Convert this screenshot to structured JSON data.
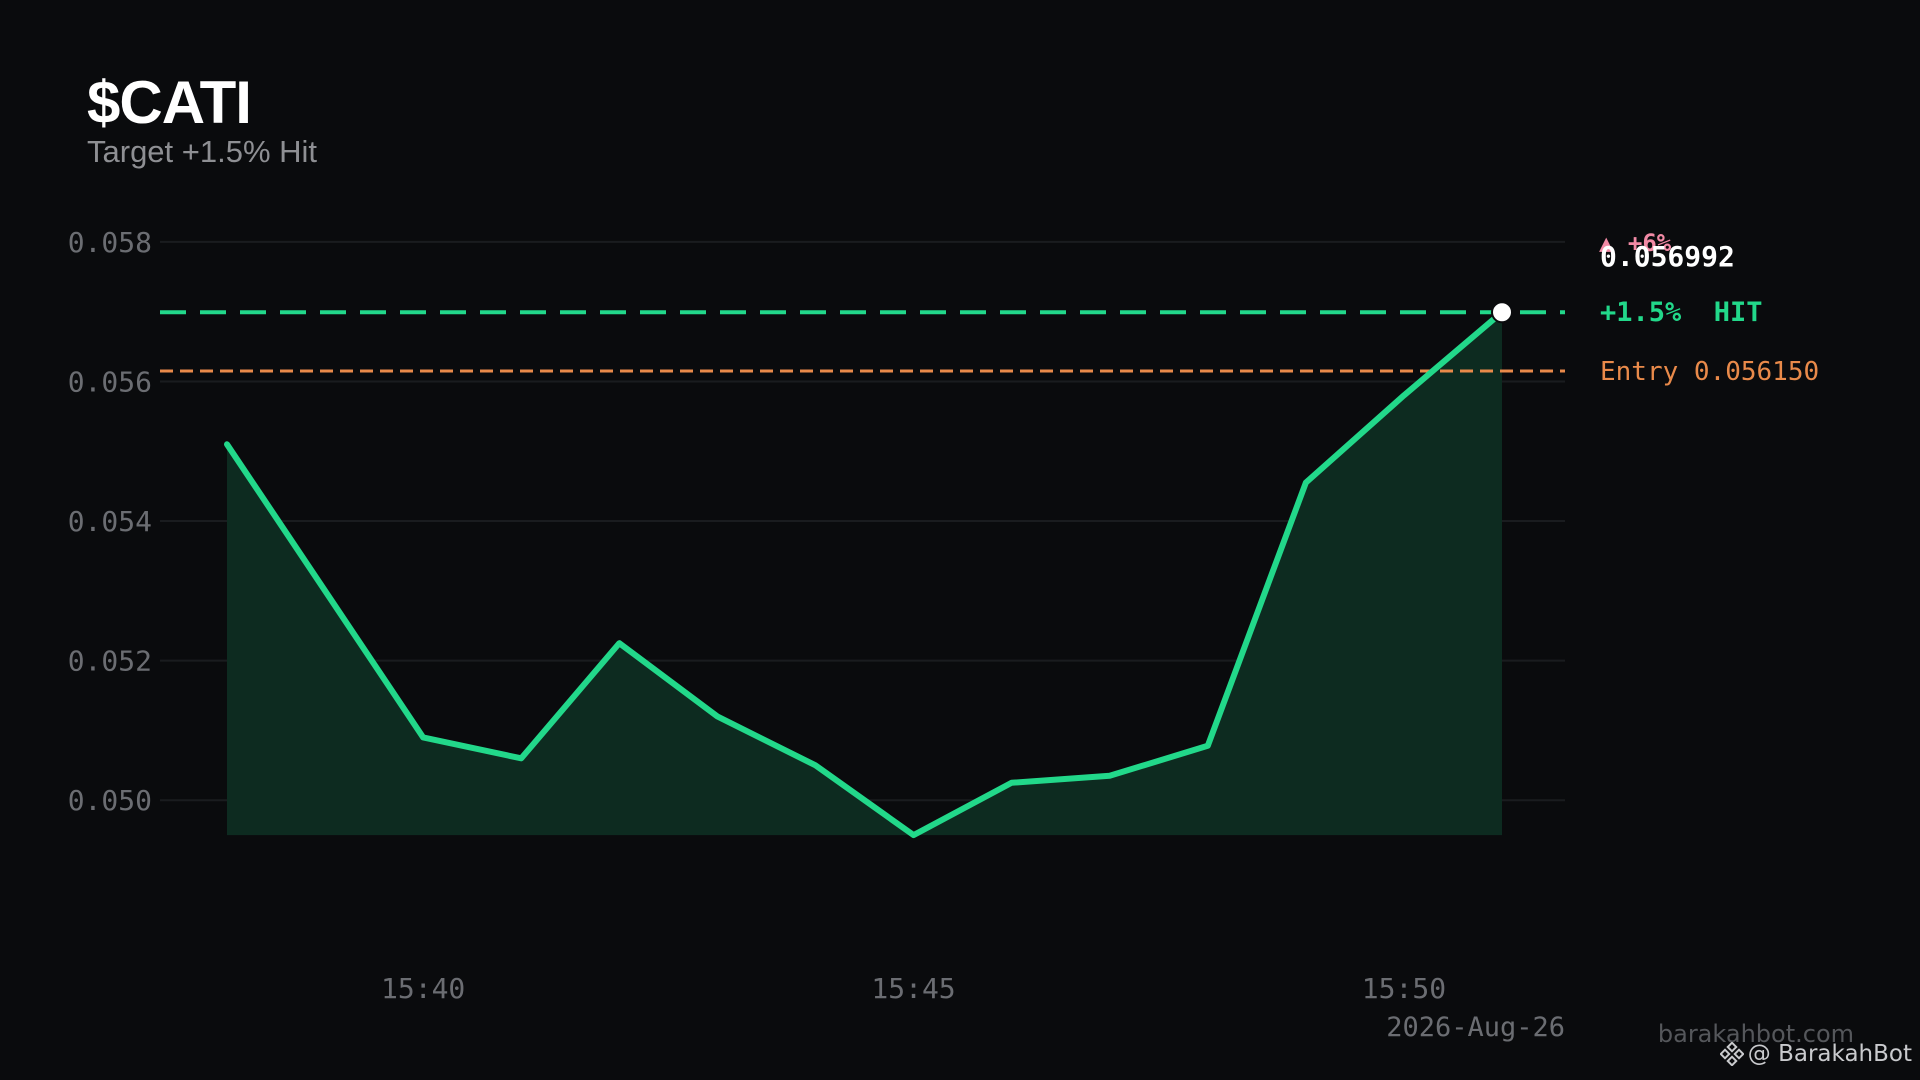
{
  "header": {
    "title": "$CATI",
    "subtitle": "Target +1.5% Hit"
  },
  "annotations": {
    "change_badge": "▲ +6%",
    "last_price": "0.056992",
    "target_label": "+1.5%  HIT",
    "entry_label": "Entry 0.056150",
    "date": "2026-Aug-26"
  },
  "footer": {
    "site": "barakahbot.com",
    "handle": "@ BarakahBot",
    "icon": "binance-logo-icon"
  },
  "colors": {
    "background": "#0a0b0d",
    "line": "#22d88a",
    "area_fill": "#0d2b20",
    "target": "#22d88a",
    "entry": "#e98a4a",
    "change_badge": "#f28aa5",
    "axis_text": "#6b6d72",
    "grid": "#1a1c1f"
  },
  "chart_data": {
    "type": "area",
    "title": "$CATI",
    "subtitle": "Target +1.5% Hit",
    "x": [
      "15:38",
      "15:39",
      "15:40",
      "15:41",
      "15:42",
      "15:43",
      "15:44",
      "15:45",
      "15:46",
      "15:47",
      "15:48",
      "15:49",
      "15:50",
      "15:51"
    ],
    "series": [
      {
        "values": [
          0.0551,
          0.053,
          0.0509,
          0.0506,
          0.05225,
          0.0512,
          0.0505,
          0.0495,
          0.05025,
          0.05035,
          0.05078,
          0.05455,
          0.0558,
          0.056992
        ]
      }
    ],
    "x_ticks": [
      "15:40",
      "15:45",
      "15:50"
    ],
    "y_ticks": [
      "0.050",
      "0.052",
      "0.054",
      "0.056",
      "0.058"
    ],
    "y_tick_values": [
      0.05,
      0.052,
      0.054,
      0.056,
      0.058
    ],
    "ylim": [
      0.049,
      0.0586
    ],
    "target_price": 0.056992,
    "entry_price": 0.05615,
    "grid": true,
    "legend": "none"
  }
}
